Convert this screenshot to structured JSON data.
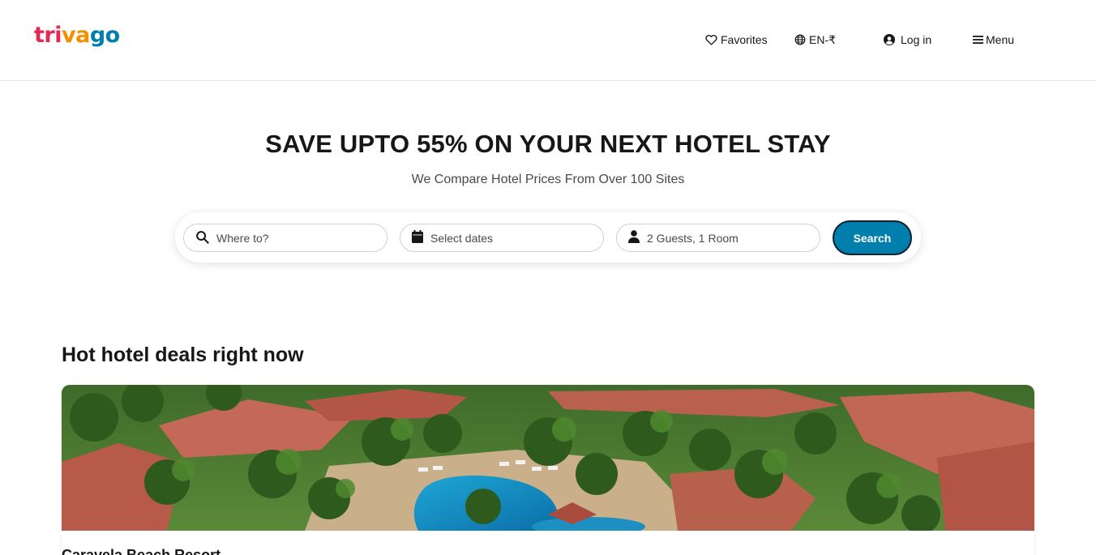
{
  "header": {
    "logo": {
      "part1": "tri",
      "part2": "va",
      "part3": "go"
    },
    "nav": {
      "favorites_label": "Favorites",
      "language_label": "EN-₹",
      "login_label": "Log in",
      "menu_label": "Menu"
    },
    "icons": [
      "heart-icon",
      "globe-icon",
      "user-circle-icon",
      "hamburger-icon"
    ]
  },
  "hero": {
    "title": "SAVE UPTO 55% ON YOUR NEXT HOTEL STAY",
    "subtitle": "We Compare Hotel Prices From Over 100 Sites"
  },
  "search": {
    "destination_placeholder": "Where to?",
    "dates_label": "Select dates",
    "guests_label": "2 Guests, 1 Room",
    "button_label": "Search",
    "icons": [
      "search-icon",
      "calendar-icon",
      "person-icon"
    ]
  },
  "deals": {
    "title": "Hot hotel deals right now",
    "items": [
      {
        "name": "Caravela Beach Resort"
      }
    ]
  },
  "colors": {
    "brand_red": "#e32851",
    "brand_orange": "#f48f00",
    "brand_blue": "#007fad",
    "text": "#171717"
  }
}
